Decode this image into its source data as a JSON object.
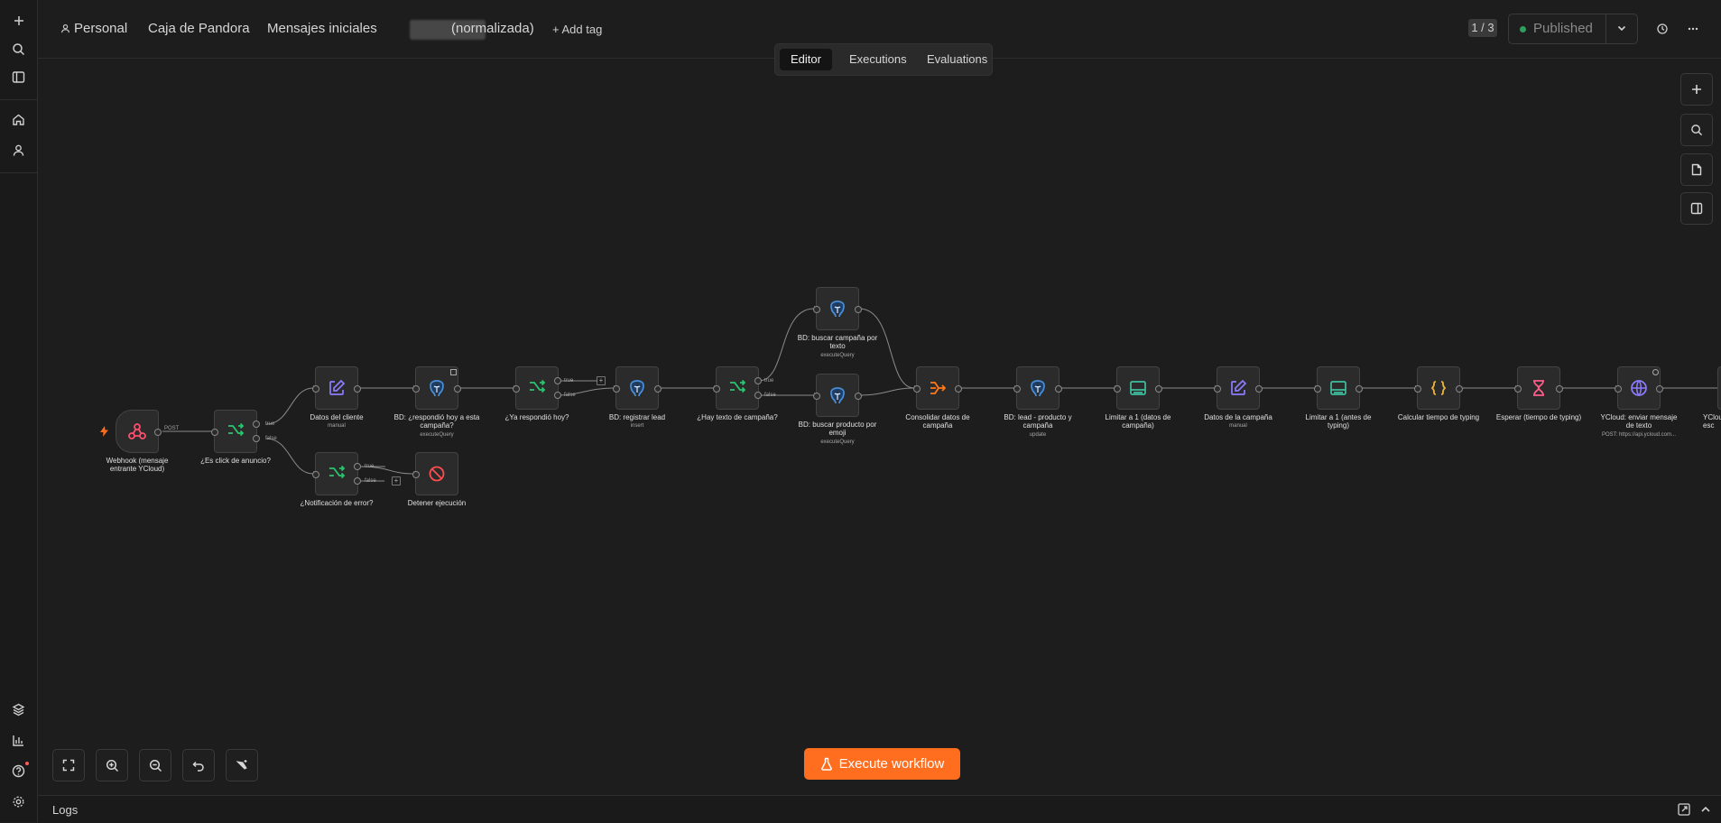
{
  "breadcrumb": {
    "project": "Personal",
    "folder": "Caja de Pandora",
    "workflow_name_start": "Mensajes iniciales",
    "workflow_name_end": "(normalizada)",
    "add_tag": "+ Add tag"
  },
  "header": {
    "version_counter": "1 / 3",
    "publish_state": "Published"
  },
  "tabs": [
    {
      "label": "Editor",
      "active": true
    },
    {
      "label": "Executions",
      "active": false
    },
    {
      "label": "Evaluations",
      "active": false
    }
  ],
  "nodes": {
    "webhook": {
      "label": "Webhook (mensaje entrante YCloud)",
      "type_icon": "webhook-icon",
      "out_label": "POST"
    },
    "es_click": {
      "label": "¿Es click de anuncio?",
      "out_true": "true",
      "out_false": "false"
    },
    "datos_cliente": {
      "label": "Datos del cliente",
      "sub": "manual"
    },
    "bd_respondio": {
      "label": "BD: ¿respondió hoy a esta campaña?",
      "sub": "executeQuery"
    },
    "ya_respondio": {
      "label": "¿Ya respondió hoy?",
      "out_true": "true",
      "out_false": "false"
    },
    "bd_registrar": {
      "label": "BD: registrar lead",
      "sub": "insert"
    },
    "hay_texto": {
      "label": "¿Hay texto de campaña?",
      "out_true": "true",
      "out_false": "false"
    },
    "bd_buscar_campana": {
      "label": "BD: buscar campaña por texto",
      "sub": "executeQuery"
    },
    "bd_buscar_producto": {
      "label": "BD: buscar producto por emoji",
      "sub": "executeQuery"
    },
    "consolidar": {
      "label": "Consolidar datos de campaña"
    },
    "bd_lead": {
      "label": "BD: lead - producto y campaña",
      "sub": "update"
    },
    "limitar1": {
      "label": "Limitar a 1 (datos de campaña)"
    },
    "datos_campana": {
      "label": "Datos de la campaña",
      "sub": "manual"
    },
    "limitar2": {
      "label": "Limitar a 1 (antes de typing)"
    },
    "calcular": {
      "label": "Calcular tiempo de typing"
    },
    "esperar": {
      "label": "Esperar (tiempo de typing)"
    },
    "ycloud_enviar": {
      "label": "YCloud: enviar mensaje de texto",
      "sub": "POST: https://api.ycloud.com..."
    },
    "ycloud_cut": {
      "label": "YClou esc"
    },
    "notificacion": {
      "label": "¿Notificación de error?",
      "out_true": "true",
      "out_false": "false"
    },
    "detener": {
      "label": "Detener ejecución"
    }
  },
  "toolbar": {
    "execute_label": "Execute workflow"
  },
  "logs": {
    "label": "Logs"
  },
  "colors": {
    "accent": "#ff6d1f",
    "published_dot": "#2f9e5e",
    "if_node": "#28c76f",
    "edit_node": "#8b7cff",
    "postgres": "#4a8fd9",
    "merge": "#ff7a1a",
    "limit": "#3fbf9f",
    "code": "#f0b43a",
    "wait": "#ff5c8a",
    "http": "#8b7cff",
    "webhook": "#ff4d6d"
  }
}
